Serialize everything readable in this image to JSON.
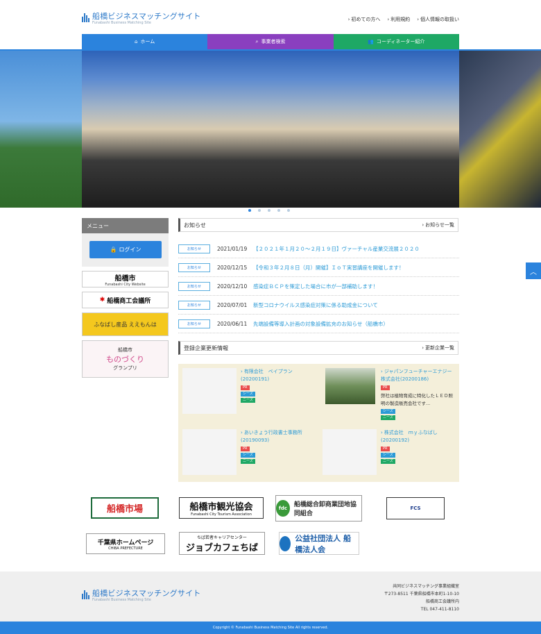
{
  "header": {
    "site_title_jp": "船橋ビジネスマッチングサイト",
    "site_title_en": "Funabashi Business Matching Site",
    "links": [
      "初めての方へ",
      "利用規約",
      "個人情報の取扱い"
    ]
  },
  "nav": {
    "home": "ホーム",
    "search": "事業者検索",
    "coordinator": "コーディネーター紹介"
  },
  "sidebar": {
    "menu_title": "メニュー",
    "login_label": "ログイン",
    "banners": {
      "city": "船橋市",
      "city_en": "Funabashi City Website",
      "chamber": "船橋商工会議所",
      "local": "ふなばし産品 ええもんは",
      "mono_top": "船橋市",
      "mono": "ものづくり",
      "mono_bottom": "グランプリ"
    }
  },
  "news": {
    "title": "お知らせ",
    "more": "お知らせ一覧",
    "tag": "お知らせ",
    "items": [
      {
        "date": "2021/01/19",
        "title": "【２０２１年１月２０～２月１９日】ヴァーチャル産業交流展２０２０"
      },
      {
        "date": "2020/12/15",
        "title": "【令和３年２月８日（月）開催】ＩｏＴ実習講座を開催します！"
      },
      {
        "date": "2020/12/10",
        "title": "感染症ＢＣＰを策定した場合に市が一部補助します！"
      },
      {
        "date": "2020/07/01",
        "title": "新型コロナウイルス感染症対策に係る助成金について"
      },
      {
        "date": "2020/06/11",
        "title": "先端設備等導入計画の対象設備拡充のお知らせ（船橋市）"
      }
    ]
  },
  "companies": {
    "title": "登録企業更新情報",
    "more": "更新企業一覧",
    "pr": "PR",
    "seeds": "シーズ",
    "needs": "ニーズ",
    "items": [
      {
        "name": "有限会社　ベイプラン (20200191)",
        "desc": ""
      },
      {
        "name": "ジャパンフューチャーエナジー株式会社(20200186)",
        "desc": "弊社は植物育成に特化したＬＥＤ照明の製造販売会社です..."
      },
      {
        "name": "あいきょう行政書士事務所 (20190093)",
        "desc": ""
      },
      {
        "name": "株式会社　ｍｙふなばし (20200192)",
        "desc": ""
      }
    ]
  },
  "bottom_banners": {
    "market": "船橋市場",
    "tourism": "船橋市観光協会",
    "tourism_en": "Funabashi City Tourism Association",
    "wholesale": "船橋総合卸商業団地協同組合",
    "fcs": "FCS",
    "chiba": "千葉県ホームページ",
    "chiba_en": "CHIBA PREFECTURE",
    "jobcafe": "ジョブカフェちば",
    "jobcafe_top": "ちば若者キャリアセンター",
    "corp": "公益社団法人 船橋法人会"
  },
  "footer": {
    "address_lines": [
      "共同ビジネスマッチング事業組織室",
      "〒273-8511 千葉県船橋市本町1-10-10",
      "船橋商工会議所内",
      "TEL 047-411-8110"
    ],
    "copyright": "Copyright © Funabashi Business Matching Site All rights reserved."
  },
  "colors": {
    "primary": "#2b83dd",
    "purple": "#8a3fbf",
    "green": "#1ea865"
  }
}
